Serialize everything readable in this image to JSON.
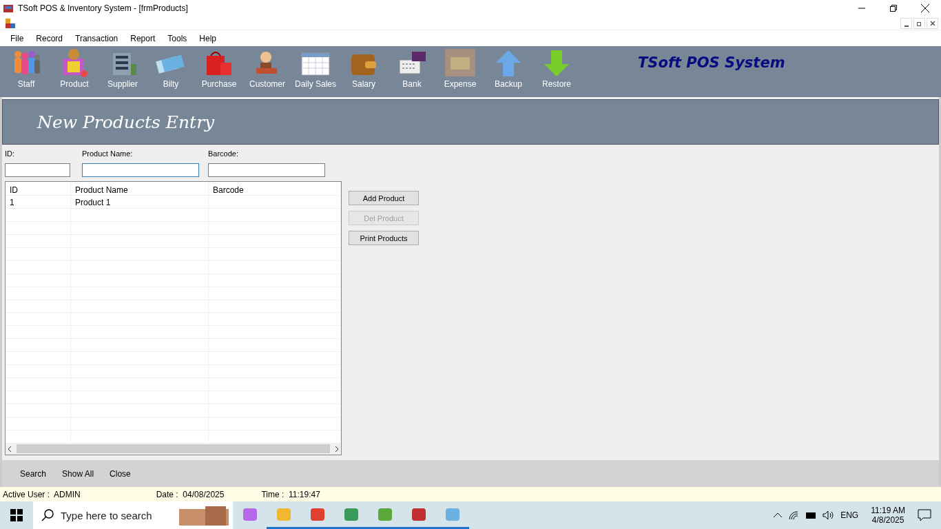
{
  "window": {
    "title": "TSoft POS & Inventory System - [frmProducts]"
  },
  "menu": [
    "File",
    "Record",
    "Transaction",
    "Report",
    "Tools",
    "Help"
  ],
  "toolbar": [
    {
      "label": "Staff"
    },
    {
      "label": "Product"
    },
    {
      "label": "Supplier"
    },
    {
      "label": "Bilty"
    },
    {
      "label": "Purchase"
    },
    {
      "label": "Customer"
    },
    {
      "label": "Daily Sales"
    },
    {
      "label": "Salary"
    },
    {
      "label": "Bank"
    },
    {
      "label": "Expense"
    },
    {
      "label": "Backup"
    },
    {
      "label": "Restore"
    }
  ],
  "brand": "TSoft POS System",
  "form": {
    "heading": "New Products Entry",
    "fields": [
      {
        "label": "ID:",
        "focused": false
      },
      {
        "label": "Product Name:",
        "focused": true
      },
      {
        "label": "Barcode:",
        "focused": false
      }
    ],
    "table": {
      "columns": [
        "ID",
        "Product Name",
        "Barcode"
      ],
      "rows": [
        [
          "1",
          "Product 1",
          ""
        ]
      ]
    },
    "buttons": [
      {
        "label": "Add Product",
        "disabled": false
      },
      {
        "label": "Del Product",
        "disabled": true
      },
      {
        "label": "Print Products",
        "disabled": false
      }
    ],
    "footer_links": [
      "Search",
      "Show All",
      "Close"
    ]
  },
  "status_bar": [
    {
      "label": "Active User :",
      "value": "ADMIN"
    },
    {
      "label": "Date :",
      "value": "04/08/2025"
    },
    {
      "label": "Time :",
      "value": "11:19:47"
    }
  ],
  "taskbar": {
    "search_placeholder": "Type here to search",
    "apps": [
      {
        "running": false
      },
      {
        "running": true
      },
      {
        "running": true
      },
      {
        "running": true
      },
      {
        "running": true
      },
      {
        "running": true
      },
      {
        "running": true
      }
    ],
    "language": "ENG",
    "time": "11:19 AM",
    "date": "4/8/2025"
  }
}
